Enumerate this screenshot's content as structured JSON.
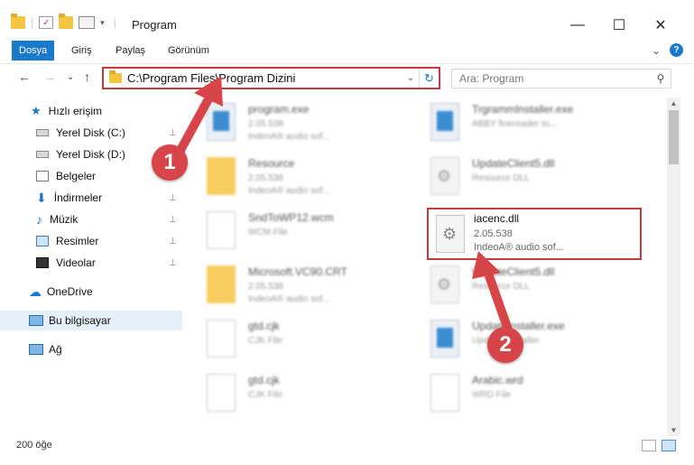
{
  "window": {
    "title": "Program",
    "minimize": "—",
    "maximize": "☐",
    "close": "✕"
  },
  "ribbon": {
    "tabs": [
      "Dosya",
      "Giriş",
      "Paylaş",
      "Görünüm"
    ],
    "expand": "⌄",
    "help": "?"
  },
  "nav": {
    "back": "←",
    "forward": "→",
    "recent": "⌄",
    "up": "↑",
    "address": "C:\\Program Files\\Program Dizini",
    "address_dropdown": "⌄",
    "refresh": "↻",
    "search_placeholder": "Ara: Program",
    "search_icon": "search-icon"
  },
  "sidebar": {
    "items": [
      {
        "label": "Hızlı erişim",
        "icon": "star-icon"
      },
      {
        "label": "Yerel Disk (C:)",
        "icon": "drive-icon",
        "pinned": true
      },
      {
        "label": "Yerel Disk (D:)",
        "icon": "drive-icon",
        "pinned": true
      },
      {
        "label": "Belgeler",
        "icon": "documents-icon",
        "pinned": true
      },
      {
        "label": "İndirmeler",
        "icon": "downloads-icon",
        "pinned": true
      },
      {
        "label": "Müzik",
        "icon": "music-icon",
        "pinned": true
      },
      {
        "label": "Resimler",
        "icon": "pictures-icon",
        "pinned": true
      },
      {
        "label": "Videolar",
        "icon": "videos-icon",
        "pinned": true
      },
      {
        "label": "OneDrive",
        "icon": "cloud-icon"
      },
      {
        "label": "Bu bilgisayar",
        "icon": "computer-icon"
      },
      {
        "label": "Ağ",
        "icon": "network-icon"
      }
    ],
    "pin_glyph": "📌"
  },
  "files": {
    "left": [
      {
        "name": "program.exe",
        "sub1": "2.05.538",
        "sub2": "IndeoA® audio sof..."
      },
      {
        "name": "Resource",
        "sub1": "2.05.538",
        "sub2": "IndeoA® audio sof..."
      },
      {
        "name": "SndToWP12.wcm",
        "sub1": "WCM File",
        "sub2": ""
      },
      {
        "name": "Microsoft.VC90.CRT",
        "sub1": "2.05.538",
        "sub2": "IndeoA® audio sof..."
      },
      {
        "name": "gtd.cjk",
        "sub1": "CJK File",
        "sub2": ""
      },
      {
        "name": "gtd.cjk",
        "sub1": "CJK File",
        "sub2": ""
      }
    ],
    "right": [
      {
        "name": "TrgrammInstaller.exe",
        "sub1": "ABBY finereader to...",
        "sub2": ""
      },
      {
        "name": "UpdateClient5.dll",
        "sub1": "Resource DLL",
        "sub2": ""
      },
      {
        "name": "iacenc.dll",
        "sub1": "2.05.538",
        "sub2": "IndeoA® audio sof..."
      },
      {
        "name": "UpdateClient5.dll",
        "sub1": "Resource DLL",
        "sub2": ""
      },
      {
        "name": "UpdateInstaller.exe",
        "sub1": "Updates installer",
        "sub2": ""
      },
      {
        "name": "Arabic.wrd",
        "sub1": "WRD File",
        "sub2": ""
      }
    ]
  },
  "status": {
    "count": "200 öğe"
  },
  "annotations": {
    "marker1": "1",
    "marker2": "2",
    "color": "#d74548"
  },
  "colors": {
    "accent": "#1979ca",
    "highlight_border": "#c8373c"
  }
}
